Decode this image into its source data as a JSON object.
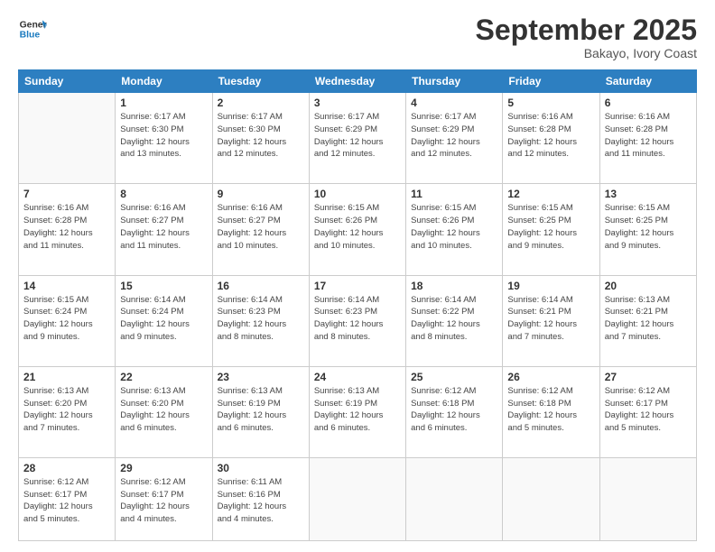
{
  "logo": {
    "text_general": "General",
    "text_blue": "Blue"
  },
  "header": {
    "month": "September 2025",
    "location": "Bakayo, Ivory Coast"
  },
  "weekdays": [
    "Sunday",
    "Monday",
    "Tuesday",
    "Wednesday",
    "Thursday",
    "Friday",
    "Saturday"
  ],
  "weeks": [
    [
      {
        "day": "",
        "info": ""
      },
      {
        "day": "1",
        "info": "Sunrise: 6:17 AM\nSunset: 6:30 PM\nDaylight: 12 hours\nand 13 minutes."
      },
      {
        "day": "2",
        "info": "Sunrise: 6:17 AM\nSunset: 6:30 PM\nDaylight: 12 hours\nand 12 minutes."
      },
      {
        "day": "3",
        "info": "Sunrise: 6:17 AM\nSunset: 6:29 PM\nDaylight: 12 hours\nand 12 minutes."
      },
      {
        "day": "4",
        "info": "Sunrise: 6:17 AM\nSunset: 6:29 PM\nDaylight: 12 hours\nand 12 minutes."
      },
      {
        "day": "5",
        "info": "Sunrise: 6:16 AM\nSunset: 6:28 PM\nDaylight: 12 hours\nand 12 minutes."
      },
      {
        "day": "6",
        "info": "Sunrise: 6:16 AM\nSunset: 6:28 PM\nDaylight: 12 hours\nand 11 minutes."
      }
    ],
    [
      {
        "day": "7",
        "info": "Sunrise: 6:16 AM\nSunset: 6:28 PM\nDaylight: 12 hours\nand 11 minutes."
      },
      {
        "day": "8",
        "info": "Sunrise: 6:16 AM\nSunset: 6:27 PM\nDaylight: 12 hours\nand 11 minutes."
      },
      {
        "day": "9",
        "info": "Sunrise: 6:16 AM\nSunset: 6:27 PM\nDaylight: 12 hours\nand 10 minutes."
      },
      {
        "day": "10",
        "info": "Sunrise: 6:15 AM\nSunset: 6:26 PM\nDaylight: 12 hours\nand 10 minutes."
      },
      {
        "day": "11",
        "info": "Sunrise: 6:15 AM\nSunset: 6:26 PM\nDaylight: 12 hours\nand 10 minutes."
      },
      {
        "day": "12",
        "info": "Sunrise: 6:15 AM\nSunset: 6:25 PM\nDaylight: 12 hours\nand 9 minutes."
      },
      {
        "day": "13",
        "info": "Sunrise: 6:15 AM\nSunset: 6:25 PM\nDaylight: 12 hours\nand 9 minutes."
      }
    ],
    [
      {
        "day": "14",
        "info": "Sunrise: 6:15 AM\nSunset: 6:24 PM\nDaylight: 12 hours\nand 9 minutes."
      },
      {
        "day": "15",
        "info": "Sunrise: 6:14 AM\nSunset: 6:24 PM\nDaylight: 12 hours\nand 9 minutes."
      },
      {
        "day": "16",
        "info": "Sunrise: 6:14 AM\nSunset: 6:23 PM\nDaylight: 12 hours\nand 8 minutes."
      },
      {
        "day": "17",
        "info": "Sunrise: 6:14 AM\nSunset: 6:23 PM\nDaylight: 12 hours\nand 8 minutes."
      },
      {
        "day": "18",
        "info": "Sunrise: 6:14 AM\nSunset: 6:22 PM\nDaylight: 12 hours\nand 8 minutes."
      },
      {
        "day": "19",
        "info": "Sunrise: 6:14 AM\nSunset: 6:21 PM\nDaylight: 12 hours\nand 7 minutes."
      },
      {
        "day": "20",
        "info": "Sunrise: 6:13 AM\nSunset: 6:21 PM\nDaylight: 12 hours\nand 7 minutes."
      }
    ],
    [
      {
        "day": "21",
        "info": "Sunrise: 6:13 AM\nSunset: 6:20 PM\nDaylight: 12 hours\nand 7 minutes."
      },
      {
        "day": "22",
        "info": "Sunrise: 6:13 AM\nSunset: 6:20 PM\nDaylight: 12 hours\nand 6 minutes."
      },
      {
        "day": "23",
        "info": "Sunrise: 6:13 AM\nSunset: 6:19 PM\nDaylight: 12 hours\nand 6 minutes."
      },
      {
        "day": "24",
        "info": "Sunrise: 6:13 AM\nSunset: 6:19 PM\nDaylight: 12 hours\nand 6 minutes."
      },
      {
        "day": "25",
        "info": "Sunrise: 6:12 AM\nSunset: 6:18 PM\nDaylight: 12 hours\nand 6 minutes."
      },
      {
        "day": "26",
        "info": "Sunrise: 6:12 AM\nSunset: 6:18 PM\nDaylight: 12 hours\nand 5 minutes."
      },
      {
        "day": "27",
        "info": "Sunrise: 6:12 AM\nSunset: 6:17 PM\nDaylight: 12 hours\nand 5 minutes."
      }
    ],
    [
      {
        "day": "28",
        "info": "Sunrise: 6:12 AM\nSunset: 6:17 PM\nDaylight: 12 hours\nand 5 minutes."
      },
      {
        "day": "29",
        "info": "Sunrise: 6:12 AM\nSunset: 6:17 PM\nDaylight: 12 hours\nand 4 minutes."
      },
      {
        "day": "30",
        "info": "Sunrise: 6:11 AM\nSunset: 6:16 PM\nDaylight: 12 hours\nand 4 minutes."
      },
      {
        "day": "",
        "info": ""
      },
      {
        "day": "",
        "info": ""
      },
      {
        "day": "",
        "info": ""
      },
      {
        "day": "",
        "info": ""
      }
    ]
  ]
}
